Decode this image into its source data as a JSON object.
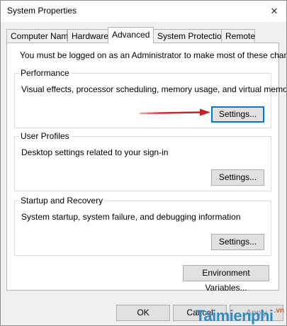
{
  "window": {
    "title": "System Properties",
    "close_glyph": "✕"
  },
  "tabs": [
    {
      "label": "Computer Name",
      "active": false
    },
    {
      "label": "Hardware",
      "active": false
    },
    {
      "label": "Advanced",
      "active": true
    },
    {
      "label": "System Protection",
      "active": false
    },
    {
      "label": "Remote",
      "active": false
    }
  ],
  "advanced": {
    "admin_note": "You must be logged on as an Administrator to make most of these changes.",
    "performance": {
      "title": "Performance",
      "description": "Visual effects, processor scheduling, memory usage, and virtual memory",
      "settings_label": "Settings..."
    },
    "user_profiles": {
      "title": "User Profiles",
      "description": "Desktop settings related to your sign-in",
      "settings_label": "Settings..."
    },
    "startup_recovery": {
      "title": "Startup and Recovery",
      "description": "System startup, system failure, and debugging information",
      "settings_label": "Settings..."
    },
    "env_vars_label": "Environment Variables..."
  },
  "dialog_buttons": {
    "ok": "OK",
    "cancel": "Cancel",
    "apply": "Apply"
  },
  "watermark": {
    "text": "Taimienphi",
    "suffix": ".vn"
  },
  "colors": {
    "arrow": "#d9262b",
    "focus": "#0078d7",
    "watermark": "#2e8bc0"
  }
}
